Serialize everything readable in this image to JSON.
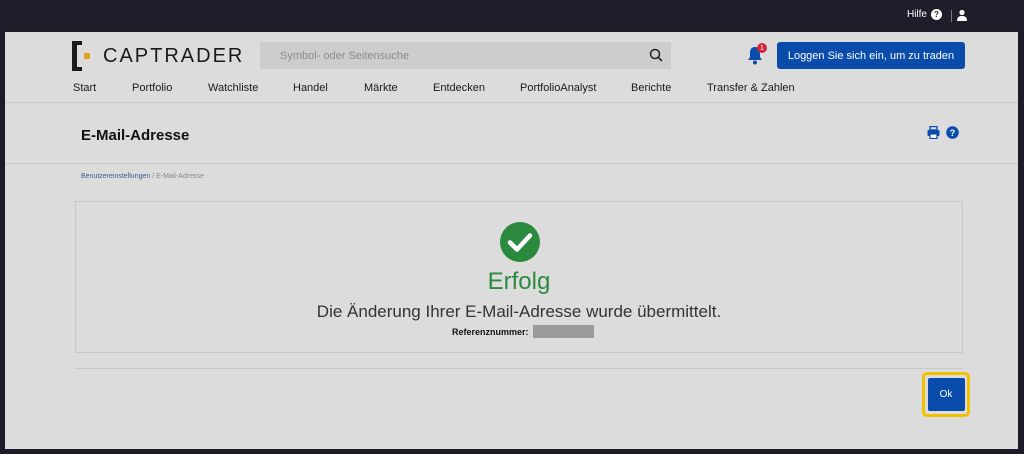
{
  "topbar": {
    "help_label": "Hilfe",
    "help_icon": "?"
  },
  "header": {
    "logo_text": "CAPTRADER",
    "search_placeholder": "Symbol- oder Seitensuche",
    "notification_count": "1",
    "login_button": "Loggen Sie sich ein, um zu traden"
  },
  "nav": [
    "Start",
    "Portfolio",
    "Watchliste",
    "Handel",
    "Märkte",
    "Entdecken",
    "PortfolioAnalyst",
    "Berichte",
    "Transfer & Zahlen"
  ],
  "page": {
    "title": "E-Mail-Adresse",
    "breadcrumb_link": "Benutzereinstellungen",
    "breadcrumb_sep": "/",
    "breadcrumb_current": "E-Mail-Adresse"
  },
  "result": {
    "status": "Erfolg",
    "message": "Die Änderung Ihrer E-Mail-Adresse wurde übermittelt.",
    "reference_label": "Referenznummer:"
  },
  "actions": {
    "ok_label": "Ok"
  },
  "colors": {
    "primary": "#0a4cab",
    "success": "#2c8a3e",
    "focus": "#f2c200",
    "alert": "#d6253a"
  }
}
